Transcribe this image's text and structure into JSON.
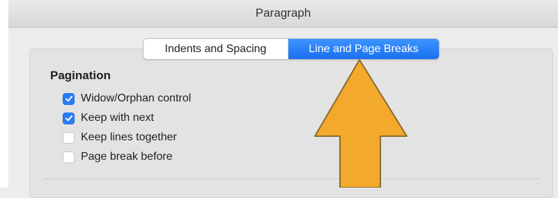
{
  "window": {
    "title": "Paragraph"
  },
  "tabs": [
    {
      "label": "Indents and Spacing",
      "selected": false
    },
    {
      "label": "Line and Page Breaks",
      "selected": true
    }
  ],
  "pagination": {
    "title": "Pagination",
    "options": [
      {
        "label": "Widow/Orphan control",
        "checked": true
      },
      {
        "label": "Keep with next",
        "checked": true
      },
      {
        "label": "Keep lines together",
        "checked": false
      },
      {
        "label": "Page break before",
        "checked": false
      }
    ]
  },
  "colors": {
    "accent": "#2a7cf6",
    "arrow": "#f3a92c",
    "arrow_outline": "#8a6a2e"
  }
}
